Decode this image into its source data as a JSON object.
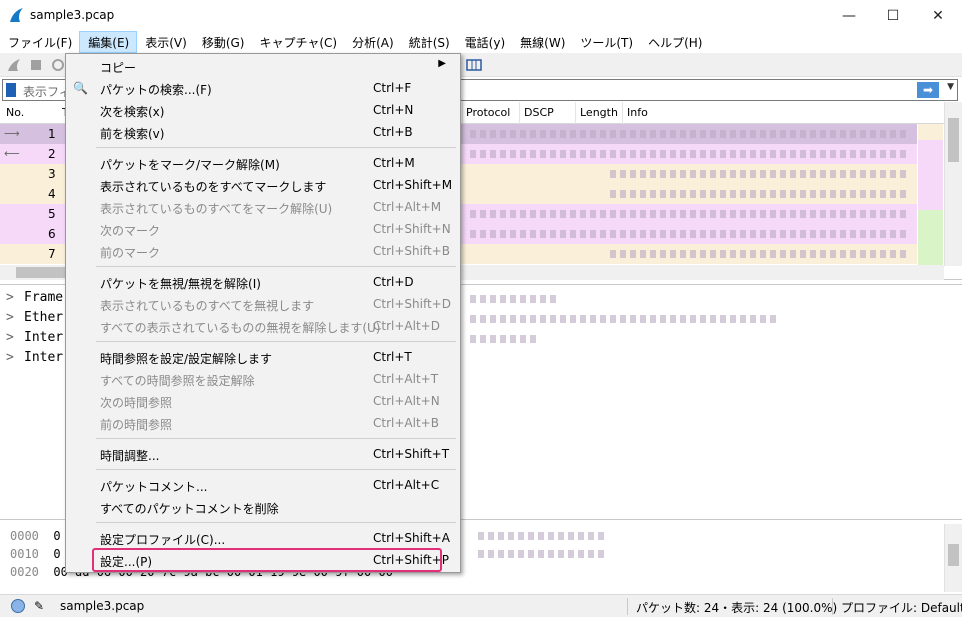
{
  "window": {
    "title": "sample3.pcap",
    "minimize": "—",
    "maximize": "☐",
    "close": "✕"
  },
  "menubar": [
    "ファイル(F)",
    "編集(E)",
    "表示(V)",
    "移動(G)",
    "キャプチャ(C)",
    "分析(A)",
    "統計(S)",
    "電話(y)",
    "無線(W)",
    "ツール(T)",
    "ヘルプ(H)"
  ],
  "filter": {
    "placeholder": "表示フィ",
    "apply": "➡",
    "dropdown": "▼"
  },
  "packet_list": {
    "headers": [
      "No.",
      "T",
      "Protocol",
      "DSCP",
      "Length",
      "Info"
    ],
    "rows": [
      "1",
      "2",
      "3",
      "4",
      "5",
      "6",
      "7"
    ]
  },
  "details": [
    "Frame",
    "Ether",
    "Inter",
    "Inter"
  ],
  "bytes": {
    "offsets": [
      "0000",
      "0010",
      "0020"
    ],
    "row0": "0",
    "row1": "0",
    "row2": "00 dd 06 00 20 7c 9a bc   00 01 19 9e 00 9f 00 00"
  },
  "edit_menu": {
    "items": [
      {
        "label": "コピー",
        "shortcut": "",
        "submenu": true,
        "disabled": false
      },
      {
        "label": "パケットの検索...(F)",
        "shortcut": "Ctrl+F",
        "icon": "🔍",
        "disabled": false
      },
      {
        "label": "次を検索(x)",
        "shortcut": "Ctrl+N",
        "disabled": false
      },
      {
        "label": "前を検索(v)",
        "shortcut": "Ctrl+B",
        "disabled": false
      },
      {
        "label": "パケットをマーク/マーク解除(M)",
        "shortcut": "Ctrl+M",
        "disabled": false
      },
      {
        "label": "表示されているものをすべてマークします",
        "shortcut": "Ctrl+Shift+M",
        "disabled": false
      },
      {
        "label": "表示されているものすべてをマーク解除(U)",
        "shortcut": "Ctrl+Alt+M",
        "disabled": true
      },
      {
        "label": "次のマーク",
        "shortcut": "Ctrl+Shift+N",
        "disabled": true
      },
      {
        "label": "前のマーク",
        "shortcut": "Ctrl+Shift+B",
        "disabled": true
      },
      {
        "label": "パケットを無視/無視を解除(I)",
        "shortcut": "Ctrl+D",
        "disabled": false
      },
      {
        "label": "表示されているものすべてを無視します",
        "shortcut": "Ctrl+Shift+D",
        "disabled": true
      },
      {
        "label": "すべての表示されているものの無視を解除します(U)",
        "shortcut": "Ctrl+Alt+D",
        "disabled": true
      },
      {
        "label": "時間参照を設定/設定解除します",
        "shortcut": "Ctrl+T",
        "disabled": false
      },
      {
        "label": "すべての時間参照を設定解除",
        "shortcut": "Ctrl+Alt+T",
        "disabled": true
      },
      {
        "label": "次の時間参照",
        "shortcut": "Ctrl+Alt+N",
        "disabled": true
      },
      {
        "label": "前の時間参照",
        "shortcut": "Ctrl+Alt+B",
        "disabled": true
      },
      {
        "label": "時間調整...",
        "shortcut": "Ctrl+Shift+T",
        "disabled": false
      },
      {
        "label": "パケットコメント...",
        "shortcut": "Ctrl+Alt+C",
        "disabled": false
      },
      {
        "label": "すべてのパケットコメントを削除",
        "shortcut": "",
        "disabled": false
      },
      {
        "label": "設定プロファイル(C)...",
        "shortcut": "Ctrl+Shift+A",
        "disabled": false
      },
      {
        "label": "設定...(P)",
        "shortcut": "Ctrl+Shift+P",
        "disabled": false
      }
    ]
  },
  "status": {
    "file": "sample3.pcap",
    "packets": "パケット数: 24・表示: 24 (100.0%)",
    "profile": "プロファイル: Default"
  },
  "colors": {
    "selected_row": "#d6c0e0",
    "pink_row": "#f6d8f8",
    "tan_row": "#faefd8",
    "highlight_box": "#e0307a",
    "menu_active": "#cce8ff"
  }
}
